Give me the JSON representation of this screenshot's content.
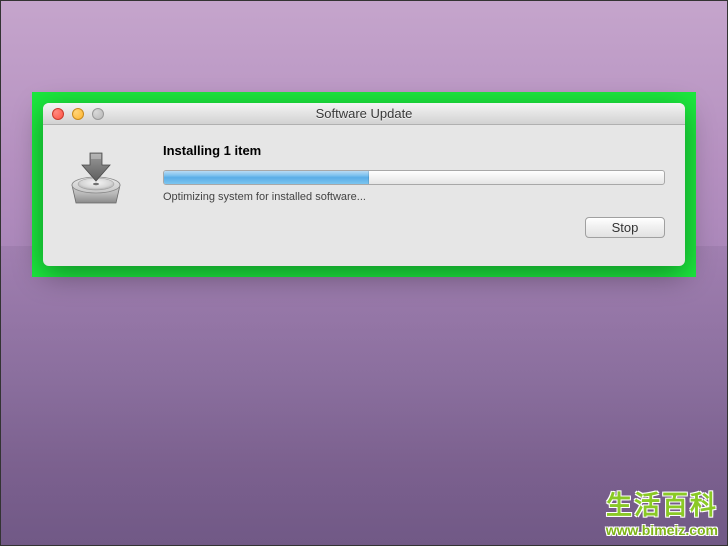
{
  "window": {
    "title": "Software Update",
    "heading": "Installing 1 item",
    "status_text": "Optimizing system for installed software...",
    "progress_percent": 41,
    "stop_label": "Stop"
  },
  "watermark": {
    "main": "生活百科",
    "url": "www.bimeiz.com"
  },
  "icons": {
    "close": "close-icon",
    "minimize": "minimize-icon",
    "zoom": "zoom-icon",
    "installer": "installer-drive-icon"
  }
}
